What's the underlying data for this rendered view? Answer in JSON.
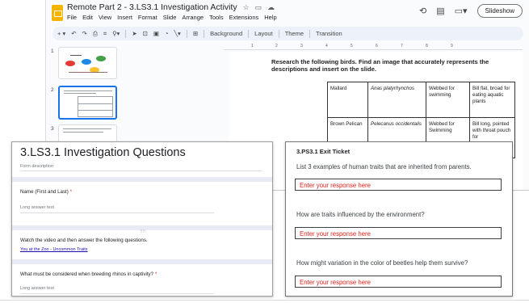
{
  "slides_app": {
    "doc_title": "Remote Part 2 - 3.LS3.1 Investigation Activity",
    "title_icons": [
      "star-icon",
      "folder-icon",
      "cloud-icon"
    ],
    "menu": [
      "File",
      "Edit",
      "View",
      "Insert",
      "Format",
      "Slide",
      "Arrange",
      "Tools",
      "Extensions",
      "Help"
    ],
    "slideshow_label": "Slideshow",
    "toolbar": {
      "background": "Background",
      "layout": "Layout",
      "theme": "Theme",
      "transition": "Transition"
    },
    "ruler_numbers": [
      "1",
      "2",
      "3",
      "4",
      "5",
      "6",
      "7",
      "8",
      "9"
    ],
    "thumbnail_numbers": [
      "1",
      "2",
      "3"
    ],
    "slide": {
      "instruction": "Research the following birds. Find an image that accurately represents the descriptions and insert on the slide.",
      "table": [
        [
          "Mallard",
          "Anas platyrhynchos",
          "Webbed for swimming",
          "Bill flat, broad for eating aquatic plants"
        ],
        [
          "Brown Pelican",
          "Pelecanus occidentalis",
          "Webbed for Swimming",
          "Bill long, pointed with throat pouch for"
        ]
      ]
    }
  },
  "form": {
    "title": "3.LS3.1 Investigation Questions",
    "description": "Form description",
    "questions": [
      {
        "label": "Name (First and Last)",
        "required_mark": "*",
        "hint": "Long answer text"
      },
      {
        "label": "Watch the video and then answer the following questions.",
        "link": "You at the Zoo - Uncommon Traits"
      },
      {
        "label": "What must be considered when breeding rhinos in captivity?",
        "required_mark": "*",
        "hint": "Long answer text"
      }
    ]
  },
  "exit_ticket": {
    "title": "3.PS3.1 Exit Ticket",
    "prompts": [
      "List 3 examples of human traits that are inherited from parents.",
      "How are traits influenced by the environment?",
      "How might variation in the color of beetles help them survive?"
    ],
    "response_placeholder": "Enter your response here"
  },
  "colors": {
    "slides_yellow": "#f4b400",
    "selection_blue": "#1a73e8",
    "required_red": "#d93025",
    "response_red": "#e2231a",
    "form_band": "#e8eaf6"
  }
}
